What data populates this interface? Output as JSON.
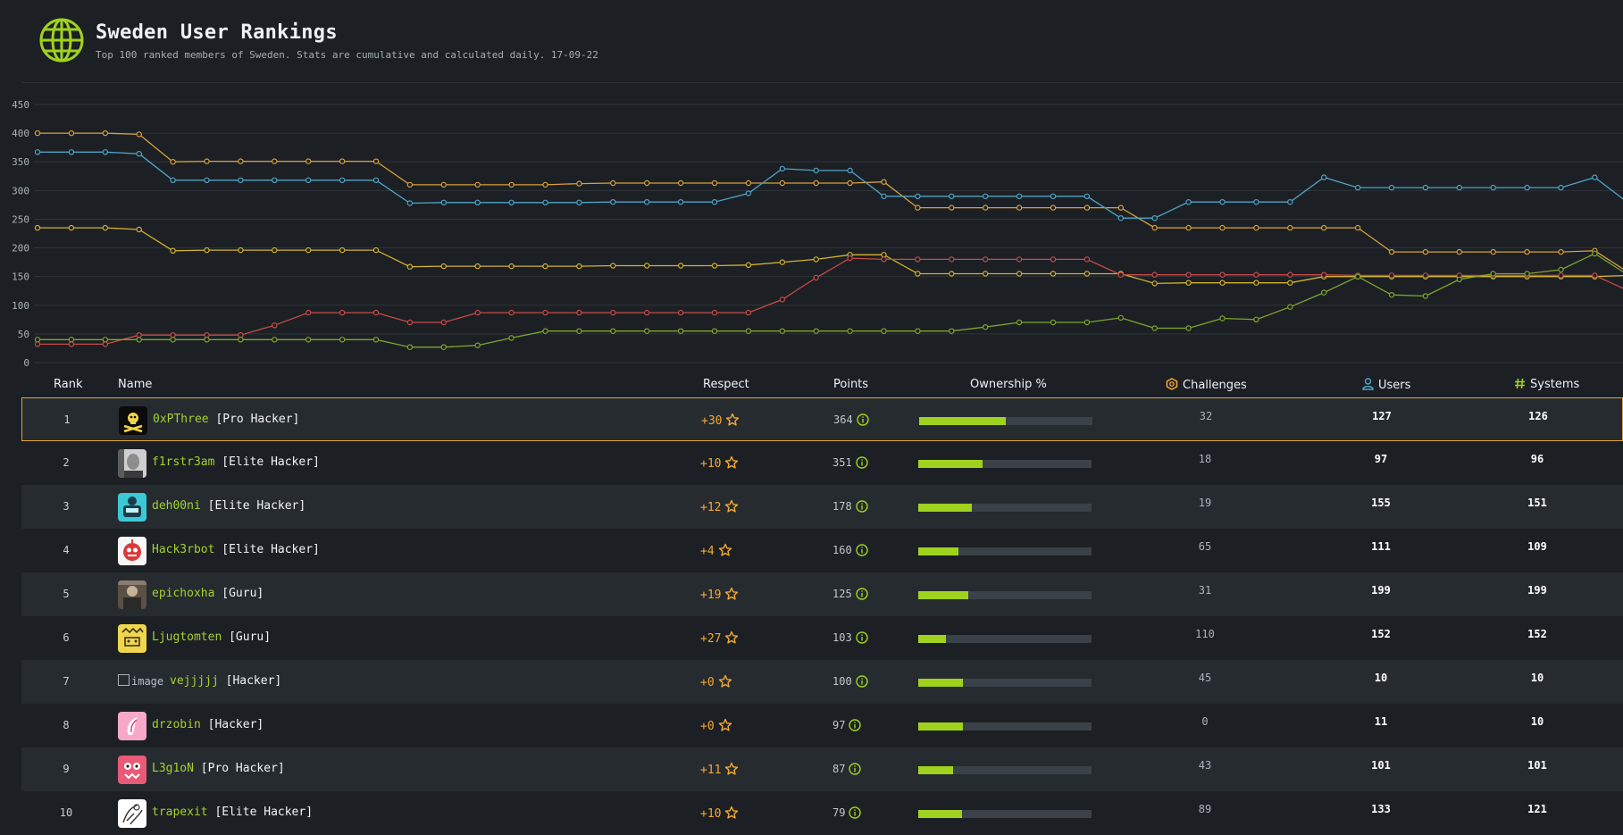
{
  "header": {
    "title": "Sweden User Rankings",
    "subtitle": "Top 100 ranked members of Sweden. Stats are cumulative and calculated daily. 17-09-22",
    "icon": "globe-icon",
    "accent": "#9fef00"
  },
  "chart_data": {
    "type": "line",
    "ylim": [
      0,
      450
    ],
    "y_ticks": [
      "0",
      "50",
      "100",
      "150",
      "200",
      "250",
      "300",
      "350",
      "400",
      "450"
    ],
    "x": [
      1,
      2,
      3,
      4,
      5,
      6,
      7,
      8,
      9,
      10,
      11,
      12,
      13,
      14,
      15,
      16,
      17,
      18,
      19,
      20,
      21,
      22,
      23,
      24,
      25,
      26,
      27,
      28,
      29,
      30,
      31,
      32,
      33,
      34,
      35,
      36,
      37,
      38,
      39,
      40,
      41,
      42,
      43,
      44,
      45,
      46,
      47,
      48
    ],
    "series": [
      {
        "color": "#d9a03a",
        "values": [
          400,
          400,
          400,
          398,
          350,
          351,
          351,
          351,
          351,
          351,
          351,
          310,
          310,
          310,
          310,
          310,
          312,
          313,
          313,
          313,
          313,
          313,
          313,
          313,
          313,
          315,
          270,
          270,
          270,
          270,
          270,
          270,
          270,
          235,
          235,
          235,
          235,
          235,
          235,
          235,
          193,
          193,
          193,
          193,
          193,
          193,
          195,
          157
        ]
      },
      {
        "color": "#4fa3c7",
        "values": [
          367,
          367,
          367,
          364,
          318,
          318,
          318,
          318,
          318,
          318,
          318,
          278,
          279,
          279,
          279,
          279,
          279,
          280,
          280,
          280,
          280,
          295,
          338,
          335,
          335,
          290,
          290,
          290,
          290,
          290,
          290,
          290,
          252,
          252,
          280,
          280,
          280,
          280,
          323,
          305,
          305,
          305,
          305,
          305,
          305,
          305,
          323,
          278
        ]
      },
      {
        "color": "#d4b12e",
        "values": [
          235,
          235,
          235,
          232,
          195,
          196,
          196,
          196,
          196,
          196,
          196,
          167,
          168,
          168,
          168,
          168,
          168,
          169,
          169,
          169,
          169,
          170,
          175,
          180,
          188,
          188,
          155,
          155,
          155,
          155,
          155,
          155,
          155,
          138,
          139,
          139,
          139,
          139,
          150,
          150,
          150,
          150,
          150,
          150,
          150,
          150,
          150,
          152
        ]
      },
      {
        "color": "#c84a48",
        "values": [
          32,
          32,
          32,
          48,
          48,
          48,
          48,
          65,
          87,
          87,
          87,
          70,
          70,
          87,
          87,
          87,
          87,
          87,
          87,
          87,
          87,
          87,
          110,
          148,
          182,
          180,
          180,
          180,
          180,
          180,
          180,
          180,
          153,
          153,
          153,
          153,
          153,
          153,
          153,
          152,
          152,
          152,
          152,
          152,
          152,
          152,
          152,
          125
        ]
      },
      {
        "color": "#7ea52a",
        "values": [
          40,
          40,
          40,
          40,
          40,
          40,
          40,
          40,
          40,
          40,
          40,
          27,
          27,
          30,
          43,
          55,
          55,
          55,
          55,
          55,
          55,
          55,
          55,
          55,
          55,
          55,
          55,
          55,
          62,
          70,
          70,
          70,
          78,
          60,
          60,
          77,
          75,
          97,
          122,
          150,
          118,
          116,
          145,
          155,
          155,
          162,
          190,
          152
        ]
      }
    ]
  },
  "table": {
    "headers": {
      "rank": "Rank",
      "name": "Name",
      "respect": "Respect",
      "points": "Points",
      "ownership": "Ownership %",
      "challenges": "Challenges",
      "users": "Users",
      "systems": "Systems"
    },
    "icons": {
      "challenges": "challenges-icon",
      "users": "user-icon",
      "systems": "hashtag-icon",
      "respect": "star-icon",
      "points": "info-icon"
    },
    "rows": [
      {
        "rank": "1",
        "name": "0xPThree",
        "title": "[Pro Hacker]",
        "respect": "+30",
        "points": "364",
        "ownership": 0.5,
        "challenges": "32",
        "users": "127",
        "systems": "126",
        "avatar": "skull-avatar",
        "highlight": true
      },
      {
        "rank": "2",
        "name": "f1rstr3am",
        "title": "[Elite Hacker]",
        "respect": "+10",
        "points": "351",
        "ownership": 0.37,
        "challenges": "18",
        "users": "97",
        "systems": "96",
        "avatar": "portrait-avatar"
      },
      {
        "rank": "3",
        "name": "deh00ni",
        "title": "[Elite Hacker]",
        "respect": "+12",
        "points": "178",
        "ownership": 0.31,
        "challenges": "19",
        "users": "155",
        "systems": "151",
        "avatar": "robot-avatar"
      },
      {
        "rank": "4",
        "name": "Hack3rbot",
        "title": "[Elite Hacker]",
        "respect": "+4",
        "points": "160",
        "ownership": 0.23,
        "challenges": "65",
        "users": "111",
        "systems": "109",
        "avatar": "bot-avatar"
      },
      {
        "rank": "5",
        "name": "epichoxha",
        "title": "[Guru]",
        "respect": "+19",
        "points": "125",
        "ownership": 0.29,
        "challenges": "31",
        "users": "199",
        "systems": "199",
        "avatar": "photo-avatar"
      },
      {
        "rank": "6",
        "name": "Ljugtomten",
        "title": "[Guru]",
        "respect": "+27",
        "points": "103",
        "ownership": 0.16,
        "challenges": "110",
        "users": "152",
        "systems": "152",
        "avatar": "yellow-avatar"
      },
      {
        "rank": "7",
        "name": "vejjjjj",
        "title": "[Hacker]",
        "respect": "+0",
        "points": "100",
        "ownership": 0.26,
        "challenges": "45",
        "users": "10",
        "systems": "10",
        "avatar": "broken-image",
        "broken_alt": "image"
      },
      {
        "rank": "8",
        "name": "drzobin",
        "title": "[Hacker]",
        "respect": "+0",
        "points": "97",
        "ownership": 0.26,
        "challenges": "0",
        "users": "11",
        "systems": "10",
        "avatar": "pink-avatar"
      },
      {
        "rank": "9",
        "name": "L3g1oN",
        "title": "[Pro Hacker]",
        "respect": "+11",
        "points": "87",
        "ownership": 0.2,
        "challenges": "43",
        "users": "101",
        "systems": "101",
        "avatar": "monster-avatar"
      },
      {
        "rank": "10",
        "name": "trapexit",
        "title": "[Elite Hacker]",
        "respect": "+10",
        "points": "79",
        "ownership": 0.25,
        "challenges": "89",
        "users": "133",
        "systems": "121",
        "avatar": "sketch-avatar"
      }
    ]
  },
  "colors": {
    "name": "#a3d12f",
    "respect": "#f3a833",
    "bar": "#9fd21f",
    "highlight_border": "#e2a33b"
  }
}
